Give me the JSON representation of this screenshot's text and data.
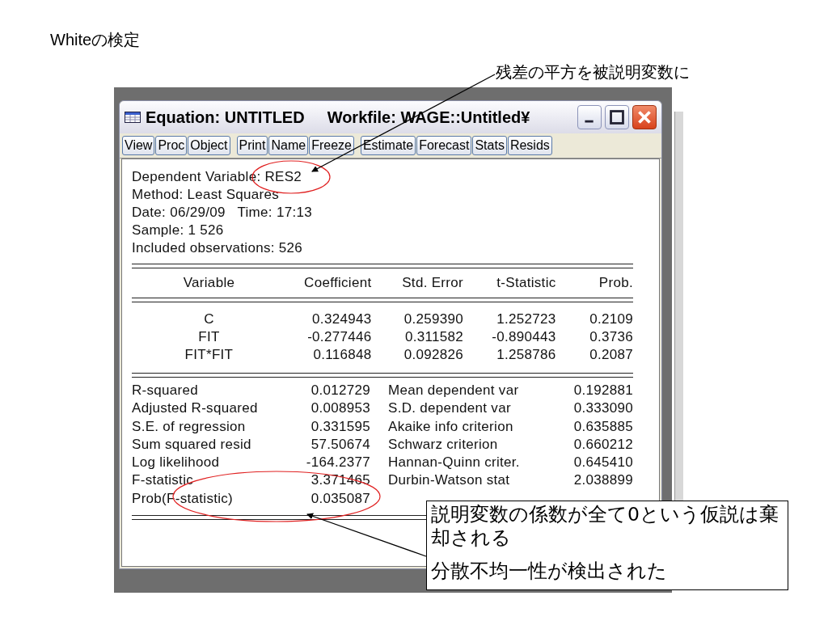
{
  "slide_title": "Whiteの検定",
  "annotation": "残差の平方を被説明変数に",
  "window": {
    "title": "Equation: UNTITLED",
    "workfile": "Workfile: WAGE::Untitled¥",
    "toolbar": [
      [
        "View",
        "Proc",
        "Object"
      ],
      [
        "Print",
        "Name",
        "Freeze"
      ],
      [
        "Estimate",
        "Forecast",
        "Stats",
        "Resids"
      ]
    ],
    "header_lines": [
      "Dependent Variable: RES2",
      "Method: Least Squares",
      "Date: 06/29/09   Time: 17:13",
      "Sample: 1 526",
      "Included observations: 526"
    ],
    "table": {
      "columns": [
        "Variable",
        "Coefficient",
        "Std. Error",
        "t-Statistic",
        "Prob."
      ],
      "rows": [
        [
          "C",
          "0.324943",
          "0.259390",
          "1.252723",
          "0.2109"
        ],
        [
          "FIT",
          "-0.277446",
          "0.311582",
          "-0.890443",
          "0.3736"
        ],
        [
          "FIT*FIT",
          "0.116848",
          "0.092826",
          "1.258786",
          "0.2087"
        ]
      ]
    },
    "stats": [
      {
        "label": "R-squared",
        "value": "0.012729",
        "label_2": "Mean dependent var",
        "value_2": "0.192881"
      },
      {
        "label": "Adjusted R-squared",
        "value": "0.008953",
        "label_2": "S.D. dependent var",
        "value_2": "0.333090"
      },
      {
        "label": "S.E. of regression",
        "value": "0.331595",
        "label_2": "Akaike info criterion",
        "value_2": "0.635885"
      },
      {
        "label": "Sum squared resid",
        "value": "57.50674",
        "label_2": "Schwarz criterion",
        "value_2": "0.660212"
      },
      {
        "label": "Log likelihood",
        "value": "-164.2377",
        "label_2": "Hannan-Quinn criter.",
        "value_2": "0.645410"
      },
      {
        "label": "F-statistic",
        "value": "3.371465",
        "label_2": "Durbin-Watson stat",
        "value_2": "2.038899"
      },
      {
        "label": "Prob(F-statistic)",
        "value": "0.035087"
      }
    ]
  },
  "callout": [
    "説明変数の係数が全て0という仮説は棄却される",
    "分散不均一性が検出された"
  ]
}
